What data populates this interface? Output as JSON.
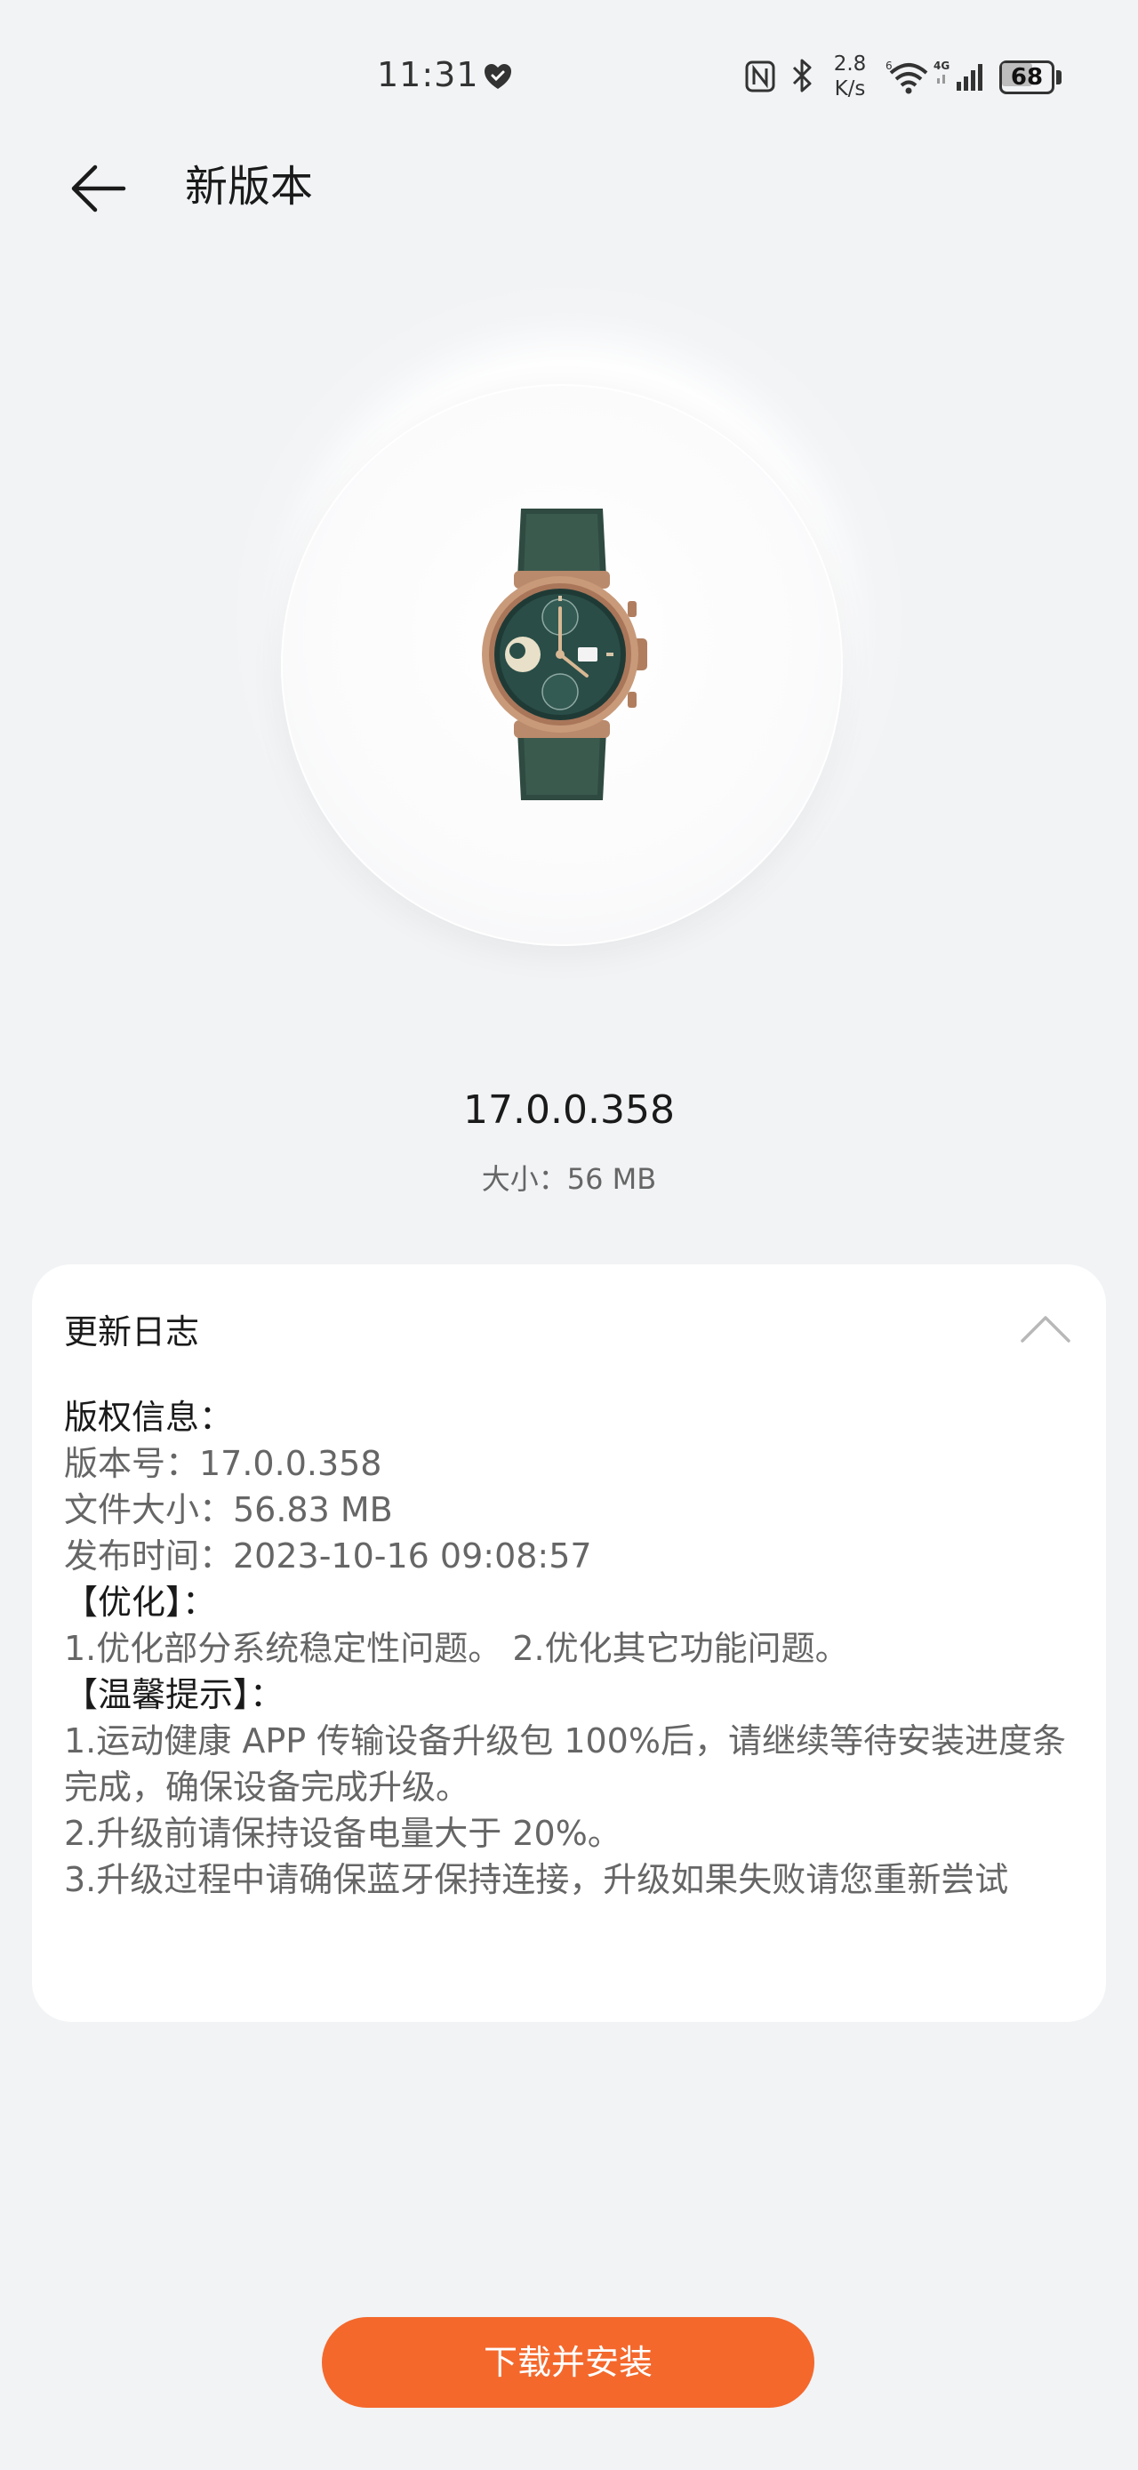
{
  "status_bar": {
    "time": "11:31",
    "net_speed_value": "2.8",
    "net_speed_unit": "K/s",
    "network_type": "4G",
    "wifi_badge": "6",
    "battery_level": "68"
  },
  "header": {
    "back_icon": "arrow-left-icon",
    "title": "新版本"
  },
  "device": {
    "image": "smartwatch-product-image"
  },
  "update": {
    "version": "17.0.0.358",
    "size": "大小：56 MB"
  },
  "changelog": {
    "title": "更新日志",
    "collapse_icon": "chevron-up-icon",
    "lines": [
      "版权信息：",
      "版本号：17.0.0.358",
      "文件大小：56.83 MB",
      "发布时间：2023-10-16 09:08:57",
      "【优化】：",
      "1.优化部分系统稳定性问题。 2.优化其它功能问题。",
      "【温馨提示】：",
      "1.运动健康 APP 传输设备升级包 100%后，请继续等待安装进度条",
      "完成，确保设备完成升级。",
      "2.升级前请保持设备电量大于 20%。",
      "3.升级过程中请确保蓝牙保持连接，升级如果失败请您重新尝试"
    ]
  },
  "actions": {
    "download_label": "下载并安装"
  },
  "colors": {
    "accent": "#f4682c",
    "background": "#f1f3f5",
    "card": "#ffffff"
  }
}
